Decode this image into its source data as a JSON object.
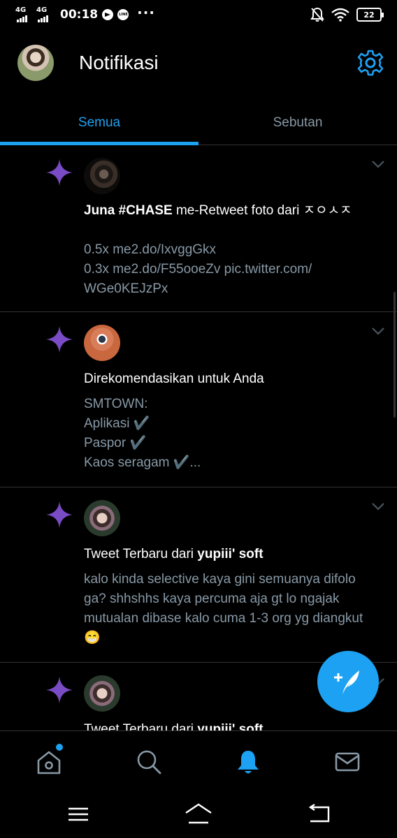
{
  "status_bar": {
    "network_1": "4G",
    "network_2": "4G",
    "time": "00:18",
    "overflow": "···",
    "battery": "22",
    "icons": [
      "telegram-icon",
      "line-icon",
      "mute-bell-icon",
      "wifi-icon",
      "battery-icon"
    ]
  },
  "header": {
    "title": "Notifikasi",
    "settings_icon": "gear-icon"
  },
  "tabs": [
    {
      "label": "Semua",
      "active": true
    },
    {
      "label": "Sebutan",
      "active": false
    }
  ],
  "colors": {
    "accent": "#1da1f2",
    "sparkle": "#794bc4",
    "muted": "#8899a6",
    "background": "#000000"
  },
  "notifications": [
    {
      "icon": "sparkle-icon",
      "avatar": "juna-avatar",
      "title_bold": "Juna #CHASE",
      "title_rest": " me-Retweet foto dari ㅈㅇㅅㅈ",
      "body": "0.5x me2.do/IxvggGkx\n0.3x me2.do/F55ooeZv pic.twitter.com/\nWGe0KEJzPx"
    },
    {
      "icon": "sparkle-icon",
      "avatar": "smtown-avatar",
      "title_bold": "",
      "title_rest": "Direkomendasikan untuk Anda",
      "body": "SMTOWN:\nAplikasi ✔️\nPaspor ✔️\nKaos seragam ✔️..."
    },
    {
      "icon": "sparkle-icon",
      "avatar": "yupiii-avatar",
      "title_rest": "Tweet Terbaru dari ",
      "title_bold": "yupiii' soft",
      "body": "kalo kinda selective kaya gini semuanya difolo ga? shhshhs kaya percuma aja gt lo ngajak mutualan dibase kalo cuma 1-3 org yg diangkut😁"
    },
    {
      "icon": "sparkle-icon",
      "avatar": "yupiii-avatar",
      "title_rest": "Tweet Terbaru dari ",
      "title_bold": "yupiii' soft",
      "body": ""
    }
  ],
  "fab": {
    "icon": "compose-tweet-icon"
  },
  "bottom_nav": [
    {
      "name": "home",
      "icon": "home-icon",
      "has_dot": true
    },
    {
      "name": "search",
      "icon": "search-icon"
    },
    {
      "name": "notifications",
      "icon": "bell-icon",
      "active": true
    },
    {
      "name": "messages",
      "icon": "mail-icon"
    }
  ],
  "system_nav": [
    "menu-icon",
    "home-icon",
    "back-icon"
  ]
}
